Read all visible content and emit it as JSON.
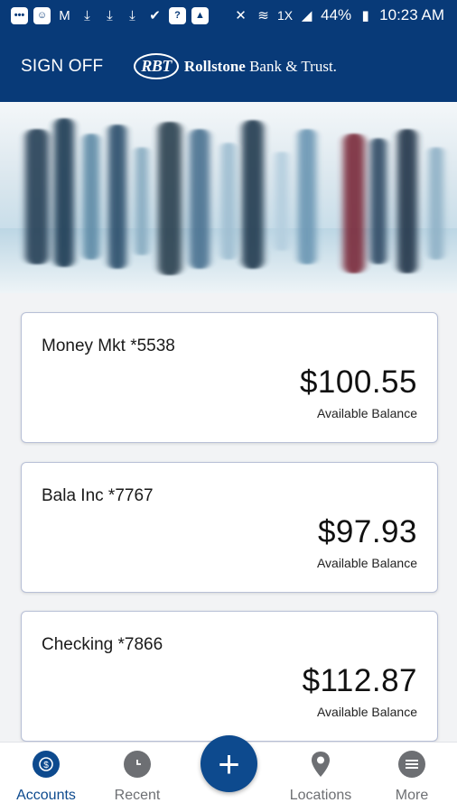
{
  "status_bar": {
    "battery": "44%",
    "time": "10:23 AM",
    "network_badge": "1X"
  },
  "header": {
    "sign_off": "SIGN OFF",
    "logo_mark": "RBT",
    "brand_name_bold": "Rollstone",
    "brand_name_rest": " Bank & Trust."
  },
  "accounts": [
    {
      "name": "Money Mkt *5538",
      "balance": "$100.55",
      "label": "Available Balance"
    },
    {
      "name": "Bala Inc *7767",
      "balance": "$97.93",
      "label": "Available Balance"
    },
    {
      "name": "Checking *7866",
      "balance": "$112.87",
      "label": "Available Balance"
    }
  ],
  "bottom_nav": {
    "accounts": "Accounts",
    "recent": "Recent",
    "add": "+",
    "locations": "Locations",
    "more": "More"
  },
  "colors": {
    "brand_navy": "#083a78",
    "accent_blue": "#0d4a8e",
    "inactive_gray": "#6d6f73"
  }
}
